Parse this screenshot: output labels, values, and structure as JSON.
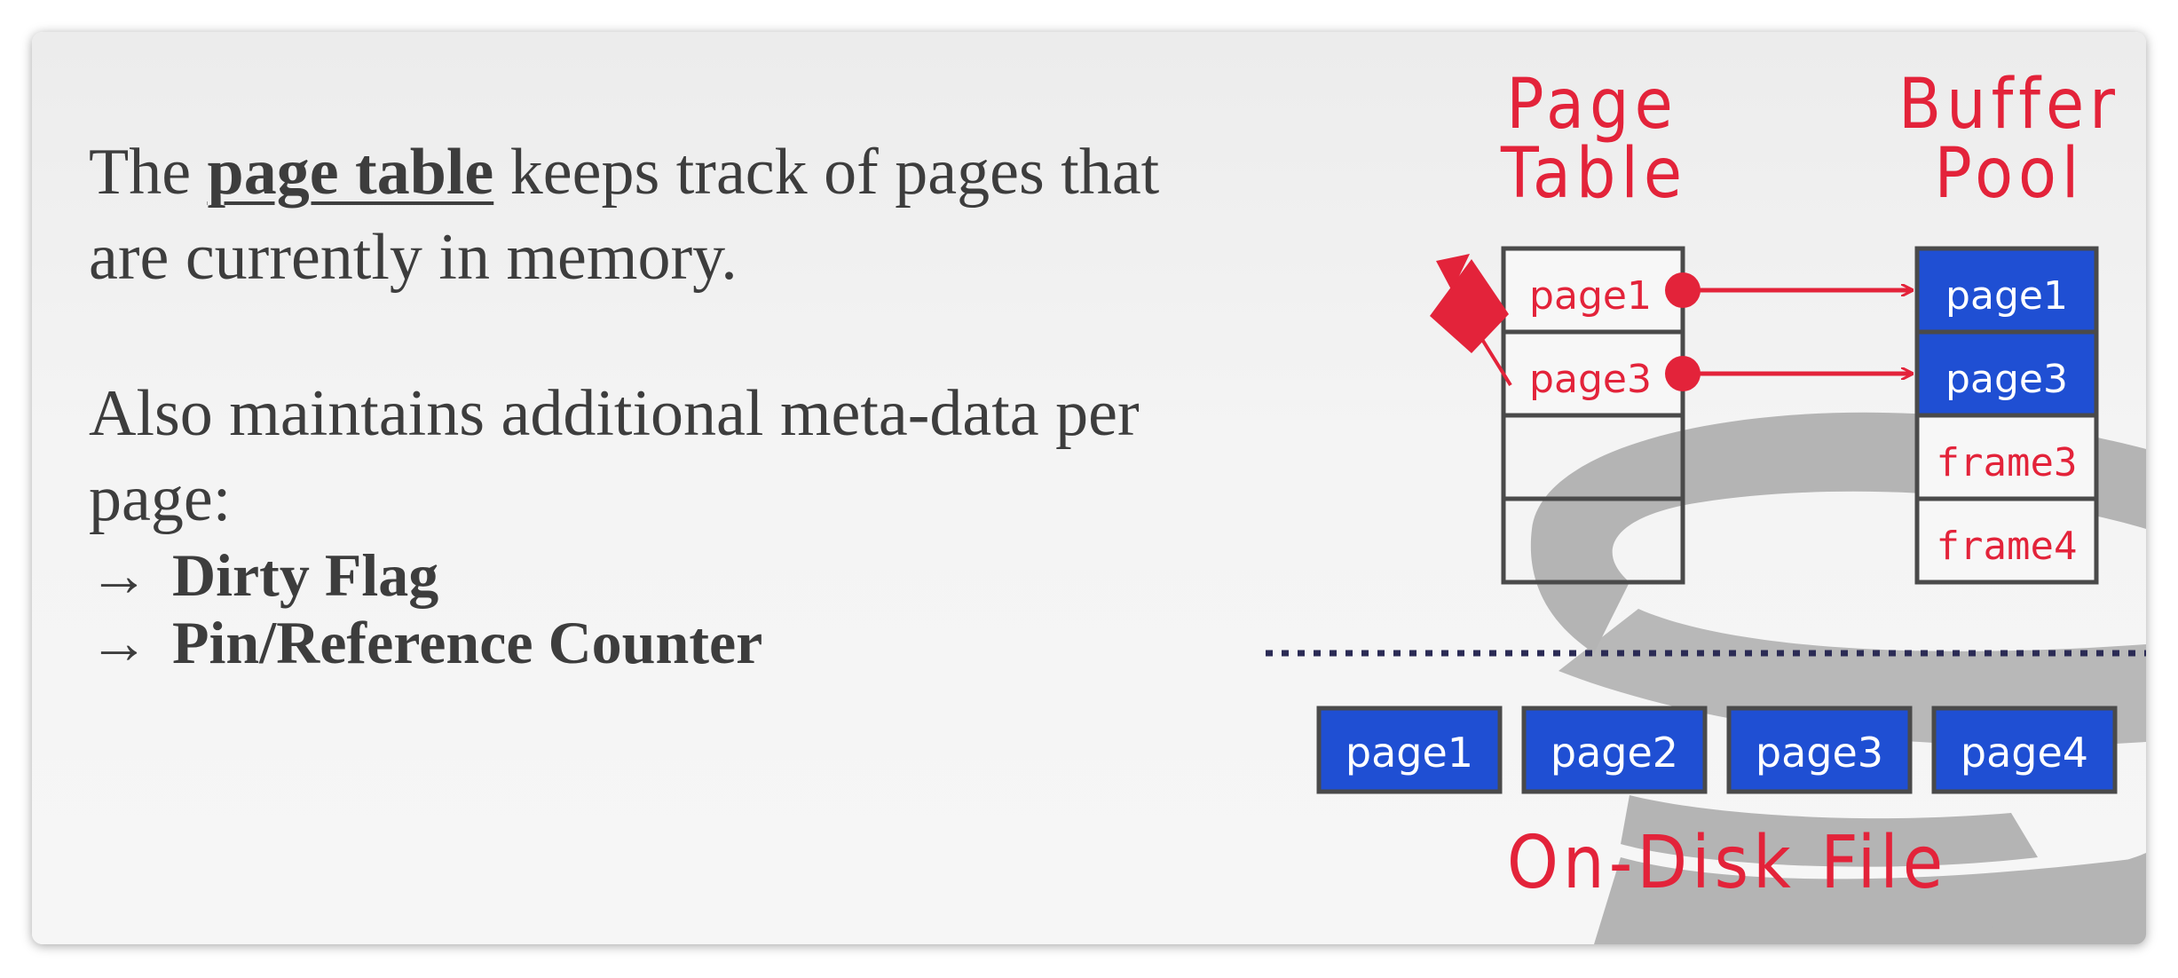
{
  "text": {
    "para1_before": "The ",
    "para1_key": "page table",
    "para1_after": " keeps track of pages that are currently in memory.",
    "para2": "Also maintains additional meta-data per page:",
    "arrow": "→",
    "bullets": [
      "Dirty Flag",
      "Pin/Reference Counter"
    ]
  },
  "diagram": {
    "page_table_title_1": "Page",
    "page_table_title_2": "Table",
    "buffer_pool_title_1": "Buffer",
    "buffer_pool_title_2": "Pool",
    "page_table_entries": [
      "page1",
      "page3",
      "",
      ""
    ],
    "buffer_pool_frames": [
      "page1",
      "page3",
      "frame3",
      "frame4"
    ],
    "disk_pages": [
      "page1",
      "page2",
      "page3",
      "page4"
    ],
    "disk_label": "On-Disk File"
  },
  "colors": {
    "accent_red": "#e3233a",
    "page_blue": "#1f4fd3",
    "box_border": "#4a4a4a",
    "separator": "#2b2b55",
    "watermark": "#b4b4b4"
  }
}
